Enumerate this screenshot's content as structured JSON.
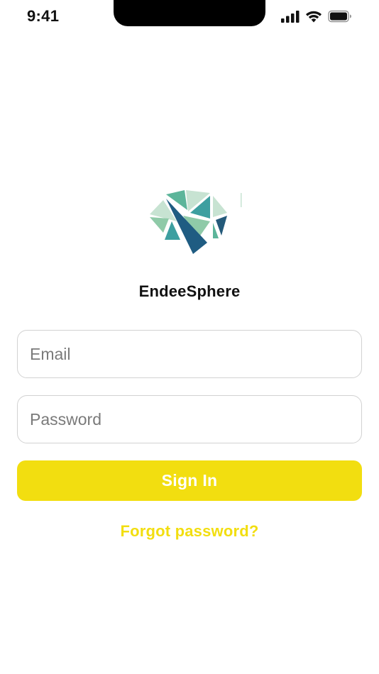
{
  "status_bar": {
    "time": "9:41",
    "icons": [
      "cellular-signal-icon",
      "wifi-icon",
      "battery-icon"
    ]
  },
  "logo": {
    "icon": "faceted-brain-logo",
    "colors": [
      "#c7e3d2",
      "#5cb59a",
      "#3d9fa0",
      "#8fcaa8",
      "#245a7a",
      "#1f5c82"
    ]
  },
  "app": {
    "name": "EndeeSphere"
  },
  "form": {
    "email_placeholder": "Email",
    "email_value": "",
    "password_placeholder": "Password",
    "password_value": "",
    "sign_in_label": "Sign In",
    "forgot_password_label": "Forgot password?"
  },
  "colors": {
    "accent": "#f2de10",
    "field_border": "#d2d2d2",
    "placeholder": "#7a7a7a"
  }
}
